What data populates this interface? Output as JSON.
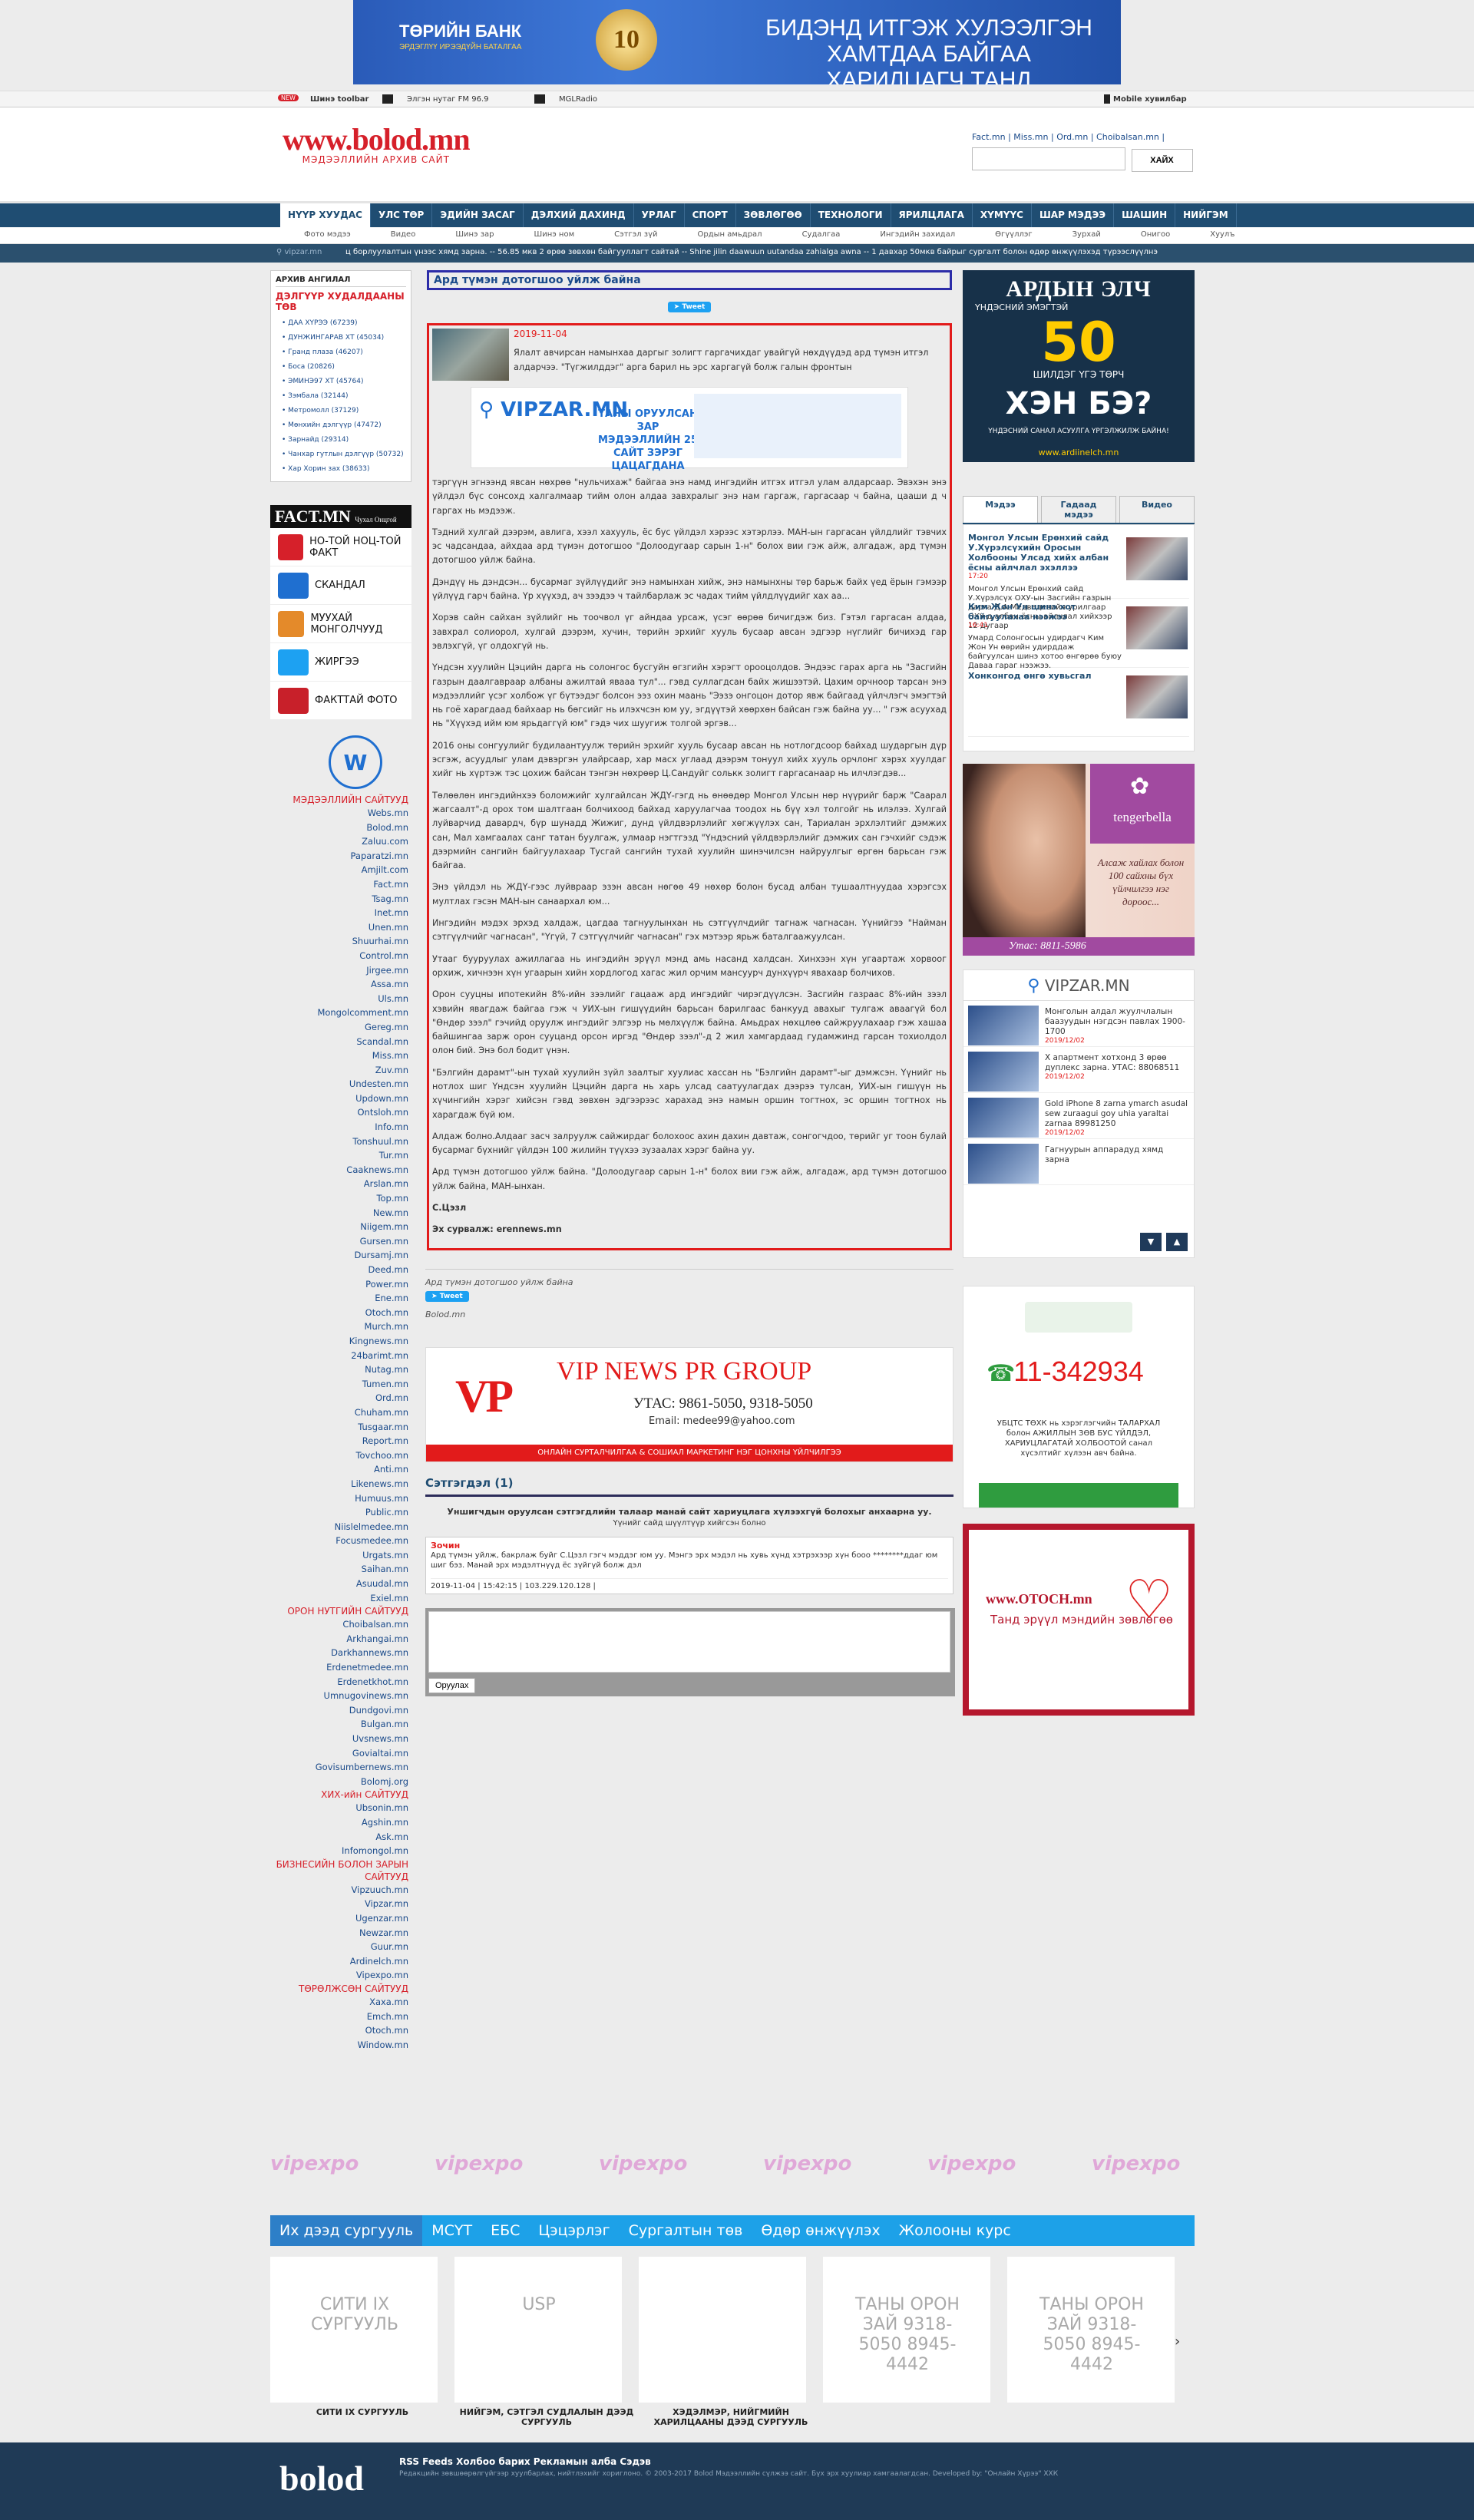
{
  "banner": {
    "bank": "ТӨРИЙН БАНК",
    "bank_sub": "ЭРДЭГЛҮҮ ИРЭЭДҮЙН БАТАЛГАА",
    "anniv": "10",
    "slogan1": "БИДЭНД ИТГЭЖ ХУЛЭЭЛГЭН ХАМТДАА БАЙГАА",
    "slogan2": "ХАРИЛЦАГЧ ТАНД БАЯРЛАЛАА"
  },
  "toolbar": {
    "new_toolbar": "Шинэ toolbar",
    "fm": "Элгэн нутаг FM 96.9",
    "mgl": "MGLRadio",
    "mobile": "Mobile хувилбар"
  },
  "header": {
    "brand": "www.bolod.mn",
    "sub": "МЭДЭЭЛЛИЙН АРХИВ САЙТ",
    "links": "Fact.mn | Miss.mn | Ord.mn | Choibalsan.mn |",
    "search_button": "ХАЙХ"
  },
  "nav": [
    "НҮҮР ХУУДАС",
    "УЛС ТӨР",
    "ЭДИЙН ЗАСАГ",
    "ДЭЛХИЙ ДАХИНД",
    "УРЛАГ",
    "СПОРТ",
    "ЗӨВЛӨГӨӨ",
    "ТЕХНОЛОГИ",
    "ЯРИЛЦЛАГА",
    "ХҮМҮҮС",
    "ШАР МЭДЭЭ",
    "ШАШИН",
    "НИЙГЭМ"
  ],
  "subnav": [
    "Фото мэдээ",
    "Видео",
    "Шинэ зар",
    "Шинэ ном",
    "Сэтгэл зүй",
    "Ордын амьдрал",
    "Судалгаа",
    "Ингэдийн захидал",
    "Өгүүллэг",
    "Зурхай",
    "Онигоо",
    "Хуулъ"
  ],
  "ticker": {
    "label": "vipzar.mn",
    "text": "ц борлуулалтын үнээс хямд зарна. -- 56.85 мкв 2 өрөө зөвхөн байгууллагт сайтай -- Shine jilin daawuun uutandaa zahialga awna -- 1 давхар 50мкв байрыг сургалт болон өдөр өнжүүлэхэд түрээслүүлнэ"
  },
  "left": {
    "archive_title": "АРХИВ АНГИЛАЛ",
    "archive_big": "ДЭЛГҮҮР ХУДАЛДААНЫ ТӨВ",
    "archive": [
      "ДАА ХҮРЭЭ (67239)",
      "ДУНЖИНГАРАВ ХТ (45034)",
      "Гранд плаза (46207)",
      "Боса (20826)",
      "ЭМИНЭ97 ХТ (45764)",
      "Зэмбала (32144)",
      "Метромолл (37129)",
      "Мөнхийн дэлгүүр (47472)",
      "Зарнайд (29314)",
      "Чанхар гутлын дэлгүүр (50732)",
      "Хар Хорин зах (38633)"
    ],
    "fact_hd": "FACT.MN",
    "fact_sub": "Чухал Онцгой",
    "fact": [
      "НО-ТОЙ НОЦ-ТОЙ ФАКТ",
      "СКАНДАЛ",
      "МУУХАЙ МОНГОЛЧУУД",
      "ЖИРГЭЭ",
      "ФАКТТАЙ ФОТО"
    ],
    "sites": [
      {
        "c": "МЭДЭЭЛЛИЙН САЙТУУД"
      },
      "Webs.mn",
      "Bolod.mn",
      "Zaluu.com",
      "Paparatzi.mn",
      "Amjilt.com",
      "Fact.mn",
      "Tsag.mn",
      "Inet.mn",
      "Unen.mn",
      "Shuurhai.mn",
      "Control.mn",
      "Jirgee.mn",
      "Assa.mn",
      "Uls.mn",
      "Mongolcomment.mn",
      "Gereg.mn",
      "Scandal.mn",
      "Miss.mn",
      "Zuv.mn",
      "Undesten.mn",
      "Updown.mn",
      "Ontsloh.mn",
      "Info.mn",
      "Tonshuul.mn",
      "Tur.mn",
      "Caaknews.mn",
      "Arslan.mn",
      "Top.mn",
      "New.mn",
      "Niigem.mn",
      "Gursen.mn",
      "Dursamj.mn",
      "Deed.mn",
      "Power.mn",
      "Ene.mn",
      "Otoch.mn",
      "Murch.mn",
      "Kingnews.mn",
      "24barimt.mn",
      "Nutag.mn",
      "Tumen.mn",
      "Ord.mn",
      "Chuham.mn",
      "Tusgaar.mn",
      "Report.mn",
      "Tovchoo.mn",
      "Anti.mn",
      "Likenews.mn",
      "Humuus.mn",
      "Public.mn",
      "Niislelmedee.mn",
      "Focusmedee.mn",
      "Urgats.mn",
      "Saihan.mn",
      "Asuudal.mn",
      "Exiel.mn",
      {
        "c": "ОРОН НУТГИЙН САЙТУУД"
      },
      "Choibalsan.mn",
      "Arkhangai.mn",
      "Darkhannews.mn",
      "Erdenetmedee.mn",
      "Erdenetkhot.mn",
      "Umnugovinews.mn",
      "Dundgovi.mn",
      "Bulgan.mn",
      "Uvsnews.mn",
      "Govialtai.mn",
      "Govisumbernews.mn",
      "Bolomj.org",
      {
        "c": "ХИХ-ийн САЙТУУД"
      },
      "Ubsonin.mn",
      "Agshin.mn",
      "Ask.mn",
      "Infomongol.mn",
      {
        "c": "БИЗНЕСИЙН БОЛОН ЗАРЫН САЙТУУД"
      },
      "Vipzuuch.mn",
      "Vipzar.mn",
      "Ugenzar.mn",
      "Newzar.mn",
      "Guur.mn",
      "Ardinelch.mn",
      "Vipexpo.mn",
      {
        "c": "ТӨРӨЛЖСӨН САЙТУУД"
      },
      "Xaxa.mn",
      "Emch.mn",
      "Otoch.mn",
      "Window.mn"
    ]
  },
  "article": {
    "title": "Ард түмэн дотогшоо уйлж байна",
    "tweet": "Tweet",
    "date": "2019-11-04",
    "lead": "Ялалт авчирсан намынхаа даргыг золигт гаргачихдаг увайгүй  нөхдүүдэд ард түмэн итгэл алдарчээ. \"Түгжилддэг\" арга барил нь эрс харгагүй болж галын фронтын",
    "vip_l": "VIPZAR.MN",
    "vip_t": "ТАНЫ ОРУУЛСАН ЗАР МЭДЭЭЛЛИЙН 25 САЙТ ЗЭРЭГ ЦАЦАГДАНА",
    "paras": [
      "тэргүүн эгнээнд явсан нөхрөө \"нульчихаж\" байгаа энэ намд ингэдийн итгэх итгэл улам алдарсаар. Эвэхэн энэ үйлдэл бүс сонсохд халгалмаар тийм олон алдаа завхралыг энэ нам гаргаж, гаргасаар ч байна, цааши д ч гаргах нь мэдээж.",
      "Тэдний хулгай дээрэм, авлига, хээл хахууль, ёс бус үйлдэл хэрээс хэтэрлээ. МАН-ын гаргасан үйлдлийг тэвчих эс чадсандаа, айхдаа ард түмэн дотогшоо \"Долоодугаар сарын 1-н\" болох вии гэж айж, алгадаж, ард түмэн дотогшоо уйлж байна.",
      "Дэндүү нь дэндсэн... бусармаг зүйлүүдийг энэ намынхан хийж, энэ намынхны төр барьж байх үед ёрын гэмээр үйлүүд гарч байна. Үр хүүхэд, ач зээдээ ч тайлбарлаж эс чадах тийм үйлдлүүдийг хах аа...",
      "Хорэв сайн сайхан зүйлийг нь тоочвол үг айндаа урсаж, үсэг өөрөө бичигдэж биз. Гэтэл гаргасан алдаа, завхрал солиорол, хулгай дээрэм, хучин, төрийн эрхийг хууль бусаар авсан эдгээр нүглийг бичихэд гар эвлэхгүй, үг олдохгүй нь.",
      "Үндсэн хуулийн Цэцийн дарга нь солонгос бусгуйн өгзгийн хэрэгт орооцолдов. Эндээс гарах арга нь \"Засгийн газрын даалгавраар албаны ажилтай явааа тул\"... гэвд суллагдсан байх жишээтэй. Цахим орчноор тарсан энэ мэдээллийг үсэг холбож үг бүтээдэг болсон ээз охин маань \"Ээзэ онгоцон дотор явж байгаад үйлчлэгч эмэгтэй нь гоё харагдаад байхаар нь бөгсийг нь илэхчсэн юм уу, эгдүүтэй хөөрхөн байсан  гэж байна уу... \" гэж асуухад нь \"Хүүхэд ийм юм ярьдаггүй юм\" гэдэ чих шуугиж толгой эргэв...",
      "2016 оны сонгуулийг будилаантуулж төрийн эрхийг хууль бусаар авсан нь нотлогдсоор байхад шударгын дүр эсгэж, асуудлыг улам дэвэргэн улайрсаар, хар масх углаад дээрэм тонуул хийх хууль орчлонг хэрэх хуулдаг хийг нь хүртэж тэс цохиж байсан тэнгэн нөхрөөр Ц.Сандуйг  солькк золигт гаргасанаар нь илчлэгдэв...",
      "Төлөөлөн ингэдийнхээ боломжийг хулгайлсан ЖДҮ-гэгд нь өнөөдөр Монгол Улсын нөр нүүрийг барж \"Саарал жагсаалт\"-д орох том шалтгаан болчихоод байхад харуулагчаа тоодох нь  бүү хэл толгойг нь илэлээ. Хулгай луйварчид давардч, бүр шунадд Жижиг, дунд үйлдвэрлэлийг хөгжүүлэх сан, Тариалан эрхлэлтийг дэмжих сан, Мал хамгаалах санг татан буулгаж, улмаар нэгтгэзд \"Үндэсний үйлдвэрлэлийг дэмжих сан гэчхийг сэдэж дээрмийн сангийн байгуулахаар Тусгай сангийн тухай хуулийн шинэчилсэн найруулгыг өргөн барьсан гэж байгаа.",
      "Энэ үйлдэл нь ЖДҮ-гээс луйвраар эзэн авсан нөгөө  49 нөхөр болон бусад албан тушаалтнуудаа хэрэгсэх мултлах гэсэн МАН-ын санаархал юм...",
      "Ингэдийн мэдэх эрхэд халдаж, цагдаа тагнуулынхан нь сэтгүүлчдийг тагнаж чагнасан. Үүнийгээ \"Найман сэтгүүлчийг чагнасан\", \"Үгүй, 7 сэтгүүлчийг чагнасан\" гэх мэтээр ярьж баталгаажуулсан.",
      "Утааг бууруулах ажиллагаа нь ингэдийн эрүүл мэнд амь насанд халдсан. Хинхээн хүн угаартаж хорвоог орхиж, хичнээн хүн угаарын хийн хордлогод хагас жил орчим мансуурч дунхүүрч явахаар болчихов.",
      "Орон сууцны ипотекийн  8%-ийн зээлийг гацааж ард ингэдийг чирэгдүүлсэн. Засгийн газраас 8%-ийн зээл хэвийн явагдаж байгаа гэж ч  УИХ-ын гишүүдийн барьсан барилгаас банкууд авахыг тулгаж аваагүй бол \"Өндөр зээл\" гэчийд оруулж ингэдийг элгээр нь мөлхүүлж байна. Амьдрах нөхцлөө сайжруулахаар гэж хашаа байшингаа зарж орон сууцанд орсон иргэд \"Өндөр зээл\"-д 2 жил хамгардаад гудамжинд гарсан тохиолдол олон бий. Энэ бол бодит үнэн.",
      "\"Бэлгийн дарамт\"-ын тухай  хуулийн зүйл заалтыг хуулиас хассан нь \"Бэлгийн дарамт\"-ыг дэмжсэн. Үүнийг нь нотлох шиг Үндсэн хуулийн Цэцийн дарга нь  харь улсад саатуулагдах дээрээ тулсан, УИХ-ын гишүүн нь хүчингийн хэрэг хийсэн гэвд зөвхөн эдгээрээс харахад энэ намын оршин тогтнох, эс оршин тогтнох нь харагдаж бүй юм.",
      "Алдаж болно.Алдааг засч залруулж сайжирдаг болохоос ахин дахин давтаж, сонгогчдоо, төрийг уг тоон булай бусармаг бүхнийг үйлдэн 100 жилийн түүхээ зузаалах хэрэг байна уу.",
      "Ард түмэн дотогшоо уйлж байна. \"Долоодугаар сарын 1-н\" болох вии гэж айж, алгадаж,  ард түмэн дотогшоо уйлж байна, МАН-ынхан."
    ],
    "author": "С.Цэзл",
    "source": "Эх сурвалж: erennews.mn",
    "meta": "Ард түмэн дотогшоо уйлж байна",
    "site": "Bolod.mn"
  },
  "vipnews": {
    "title": "VIP NEWS PR GROUP",
    "phone": "УТАС: 9861-5050, 9318-5050",
    "email": "Email: medee99@yahoo.com",
    "footer": "ОНЛАЙН СУРТАЛЧИЛГАА & СОШИАЛ МАРКЕТИНГ НЭГ ЦОНХНЫ ҮЙЛЧИЛГЭЭ"
  },
  "comments": {
    "heading": "Сэтгэгдэл (1)",
    "note": "Уншигчдын оруулсан сэтгэгдлийн талаар манай сайт хариуцлага хүлээхгүй болохыг анхаарна уу.",
    "note2": "Үүнийг сайд шүүлтүүр хийгсэн болно",
    "name": "Зочин",
    "text": "Ард түмэн уйлж, бакрлаж буйг С.Цэзл гэгч мэддэг юм уу. Мэнгэ эрх мэдэл нь хувь хүнд хэтрэхээр хүн бооо ********ддаг юм шиг бэз. Манай эрх мэдэлтнүүд ёс зүйгүй болж дэл",
    "meta": "2019-11-04 | 15:42:15 | 103.229.120.128 |",
    "submit": "Оруулах"
  },
  "right": {
    "eul_h": "АРДЫН ЭЛЧ",
    "eul_1": "ҮНДЭСНИЙ ЭМЭГТЭЙ",
    "eul_big": "50",
    "eul_2": "ШИЛДЭГ ҮГЭ ТӨРЧ",
    "eul_q": "ХЭН БЭ?",
    "eul_3": "ҮНДЭСНИЙ САНАЛ АСУУЛГА ҮРГЭЛЖИЛЖ БАЙНА!",
    "eul_link": "www.ardiinelch.mn",
    "tabs": [
      "Мэдээ",
      "Гадаад мэдээ",
      "Видео"
    ],
    "news": [
      {
        "h": "Монгол Улсын Ерөнхий сайд У.Хүрэлсүхийн Оросын Холбооны Улсад хийх албан ёсны айлчлал эхэллээ",
        "t": "17:20",
        "d": "Монгол Улсын Ерөнхий сайд У.Хүрэлсүх ОХУ-ын Засгийн газрын дарга Д.А.Медведевийн урилгаар ОХУ-д албан ёсны айлчлал хийхээр 12 дугаар"
      },
      {
        "h": "Ким Жон Ун шинэ хот байгуулахаа нээжээ",
        "t": "16:41",
        "d": "Умард Солонгосын удирдагч Ким Жон Ун өөрийн удирддаж байгуулсан шинэ хотоо өнгөрөө буюу Даваа гараг нээжээ."
      },
      {
        "h": "Хонконгод өнгө хувьсгал",
        "t": "",
        "d": ""
      }
    ],
    "tenger_brand": "tengerbella",
    "tenger_text": "Алсаж хайлах болон 100 сайхны бүх үйлчилгээ нэг дороос...",
    "tenger_tel": "Утас: 8811-5986",
    "vipr_head": "VIPZAR.MN",
    "vipr": [
      {
        "t": "Монголын алдал жуулчлалын баазуудын нэгдсэн павлах 1900-1700",
        "d": "2019/12/02"
      },
      {
        "t": "Х апартмент хотхонд 3 өрөө дуплекс зарна. УТАС: 88068511",
        "d": "2019/12/02"
      },
      {
        "t": "Gold iPhone 8 zarna ymarch asudal sew zuraagui goy uhia yaraltai zarnaa 89981250",
        "d": "2019/12/02"
      },
      {
        "t": "Гагнуурын аппарадуд хямд зарна",
        "d": ""
      }
    ],
    "ubus_num": "11-342934",
    "ubus_text": "УБЦТС ТӨХК нь хэрэглэгчийн ТАЛАРХАЛ болон АЖИЛЛЫН ЗӨВ БУС ҮЙЛДЭЛ, ХАРИУЦЛАГАТАЙ ХОЛБООТОЙ санал хүсэлтийг хүлээн авч байна.",
    "otoch_url": "www.OTOCH.mn",
    "otoch_text": "Танд эрүүл мэндийн зөвлөгөө"
  },
  "expo": [
    "vipexpo",
    "vipexpo",
    "vipexpo",
    "vipexpo",
    "vipexpo",
    "vipexpo"
  ],
  "schools": {
    "tabs": [
      "Их дээд сургууль",
      "МСҮТ",
      "ЕБС",
      "Цэцэрлэг",
      "Сургалтын төв",
      "Өдөр өнжүүлэх",
      "Жолооны курс"
    ],
    "cards": [
      {
        "name": "СИТИ IX СУРГУУЛЬ",
        "text": "СИТИ IX СУРГУУЛЬ"
      },
      {
        "name": "НИЙГЭМ, СЭТГЭЛ СУДЛАЛЫН ДЭЭД СУРГУУЛЬ",
        "text": "USP"
      },
      {
        "name": "ХЭДЭЛМЭР, НИЙГМИЙН ХАРИЛЦААНЫ ДЭЭД СУРГУУЛЬ",
        "text": ""
      },
      {
        "name": "",
        "text": "ТАНЫ ОРОН ЗАЙ 9318-5050 8945-4442"
      },
      {
        "name": "",
        "text": "ТАНЫ ОРОН ЗАЙ 9318-5050 8945-4442"
      }
    ]
  },
  "footer": {
    "brand": "bolod",
    "links": "RSS Feeds   Холбоо барих   Рекламын алба   Сэдэв",
    "copy": "Редакцийн зөвшөөрөлгүйгээр хуулбарлах, нийтлэхийг хориглоно. © 2003-2017 Bolod Мэдээллийн сүлжээ сайт. Бүх эрх хуулиар хамгаалагдсан. Developed by: \"Онлайн Хүрээ\" ХХК"
  },
  "colors": {
    "nav": "#1f4d72",
    "accent": "#d6202a",
    "article_border": "#e21b1b",
    "title_border": "#2c2ca8"
  }
}
